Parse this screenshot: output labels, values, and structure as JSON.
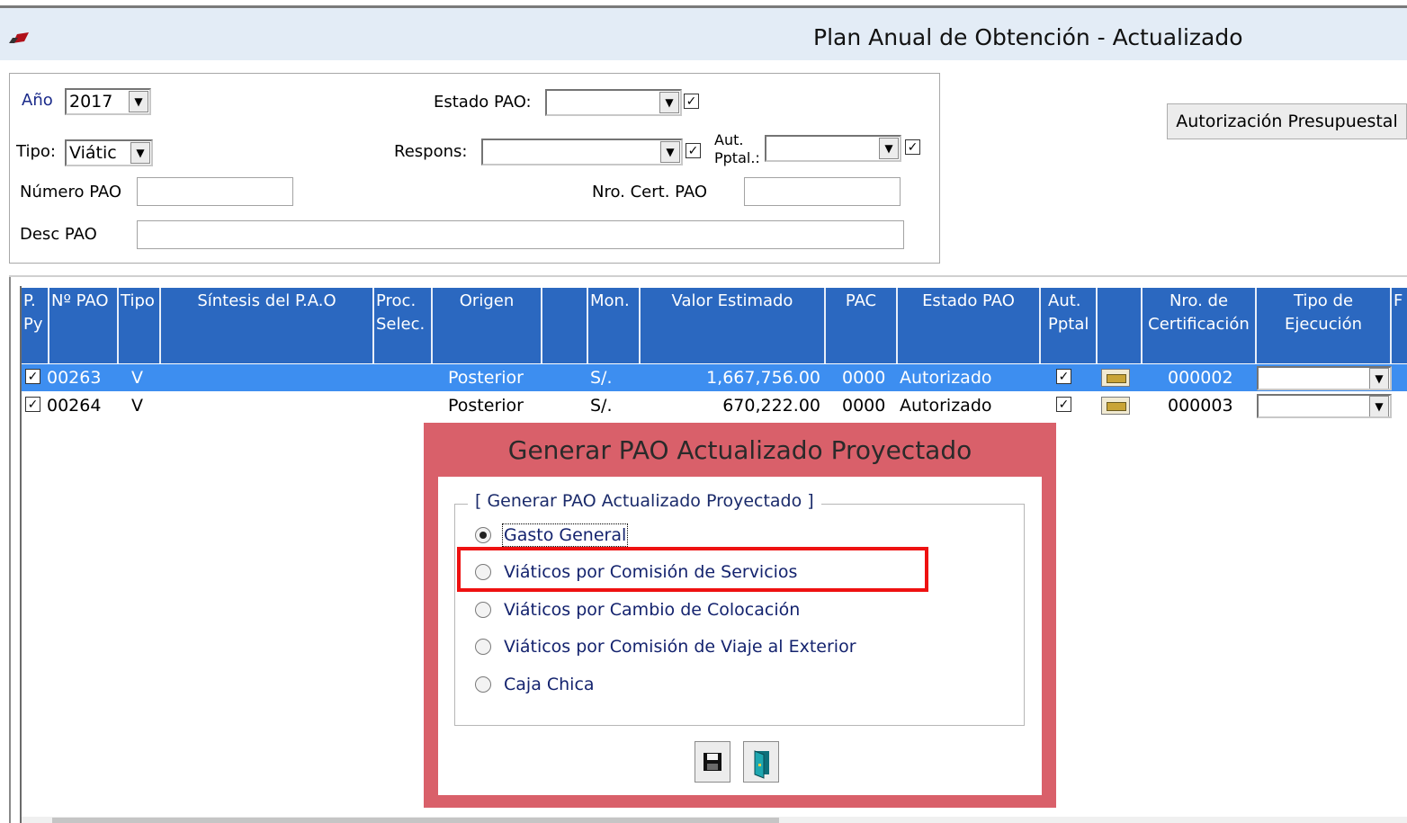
{
  "window": {
    "title": "Plan Anual de Obtención - Actualizado"
  },
  "filters": {
    "anio_label": "Año",
    "anio_value": "2017",
    "tipo_label": "Tipo:",
    "tipo_value": "Viátic",
    "numero_label": "Número PAO",
    "desc_label": "Desc PAO",
    "estado_label": "Estado PAO:",
    "estado_value": "",
    "estado_checked": true,
    "respons_label": "Respons:",
    "respons_value": "",
    "respons_checked": true,
    "aut_label_1": "Aut.",
    "aut_label_2": "Pptal.:",
    "aut_value": "",
    "aut_checked": true,
    "cert_label": "Nro. Cert. PAO"
  },
  "autorizacion_button": "Autorización Presupuestal",
  "grid": {
    "headers": [
      "P. Py",
      "Nº PAO",
      "Tipo",
      "Síntesis del P.A.O",
      "Proc. Selec.",
      "Origen",
      "",
      "Mon.",
      "Valor Estimado",
      "PAC",
      "Estado PAO",
      "Aut. Pptal",
      "",
      "Nro. de Certificación",
      "Tipo de Ejecución",
      "F"
    ],
    "rows": [
      {
        "py": true,
        "num": "00263",
        "tipo": "V",
        "origen": "Posterior",
        "mon": "S/.",
        "valor": "1,667,756.00",
        "pac": "0000",
        "estado": "Autorizado",
        "aut": true,
        "cert": "000002",
        "selected": true
      },
      {
        "py": true,
        "num": "00264",
        "tipo": "V",
        "origen": "Posterior",
        "mon": "S/.",
        "valor": "670,222.00",
        "pac": "0000",
        "estado": "Autorizado",
        "aut": true,
        "cert": "000003",
        "selected": false
      }
    ]
  },
  "dialog": {
    "title": "Generar PAO Actualizado Proyectado",
    "group_label": "[ Generar PAO Actualizado Proyectado ]",
    "options": [
      {
        "label": "Gasto General",
        "selected": true
      },
      {
        "label": "Viáticos por Comisión de Servicios",
        "selected": false
      },
      {
        "label": "Viáticos por Cambio de Colocación",
        "selected": false
      },
      {
        "label": "Viáticos por Comisión de Viaje al Exterior",
        "selected": false
      },
      {
        "label": "Caja Chica",
        "selected": false
      }
    ],
    "highlight_color": "#ee1111",
    "buttons": [
      {
        "icon": "save-icon"
      },
      {
        "icon": "exit-door-icon"
      }
    ]
  },
  "colors": {
    "header_blue": "#2b68c0",
    "selection_blue": "#3d8ef0",
    "dialog_frame": "#d9606a",
    "titlebar": "#e3ecf6"
  }
}
